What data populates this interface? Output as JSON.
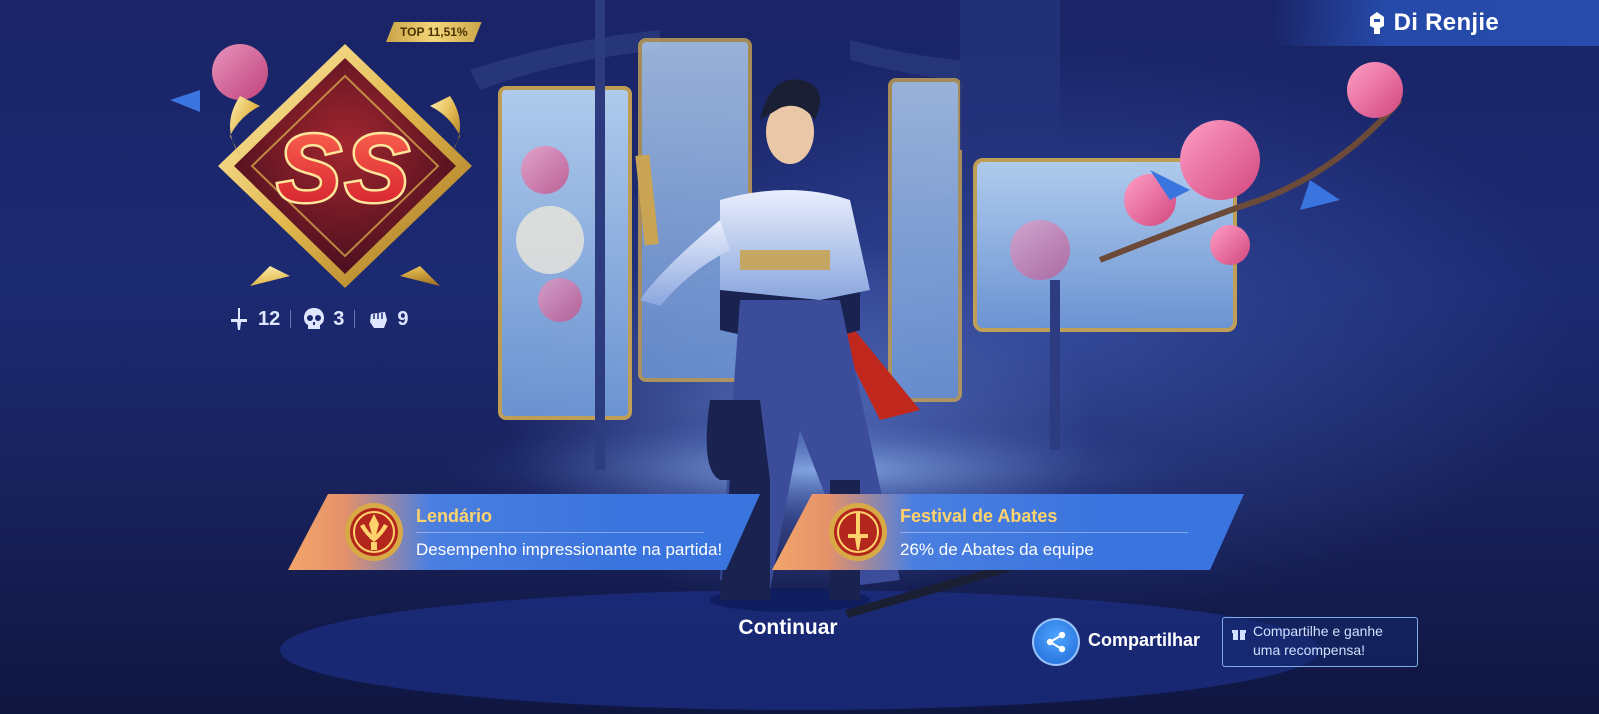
{
  "header": {
    "hero_name": "Di Renjie",
    "hero_icon": "helmet-icon"
  },
  "rank": {
    "grade": "SS",
    "top_label": "TOP 11,51%"
  },
  "kda": {
    "kills": "12",
    "deaths": "3",
    "assists": "9",
    "icons": [
      "sword-icon",
      "skull-icon",
      "fist-icon"
    ]
  },
  "achievements": [
    {
      "title": "Lendário",
      "description": "Desempenho impressionante na partida!",
      "icon": "medal-icon"
    },
    {
      "title": "Festival de Abates",
      "description": "26% de Abates da equipe",
      "icon": "medal-icon"
    }
  ],
  "actions": {
    "continue_label": "Continuar",
    "share_label": "Compartilhar",
    "share_tip_line1": "Compartilhe e ganhe",
    "share_tip_line2": "uma recompensa!"
  },
  "colors": {
    "accent_gold": "#ffd36b",
    "banner_blue": "#3a74de",
    "banner_orange": "#f3a66a",
    "rank_red": "#e8322b"
  }
}
